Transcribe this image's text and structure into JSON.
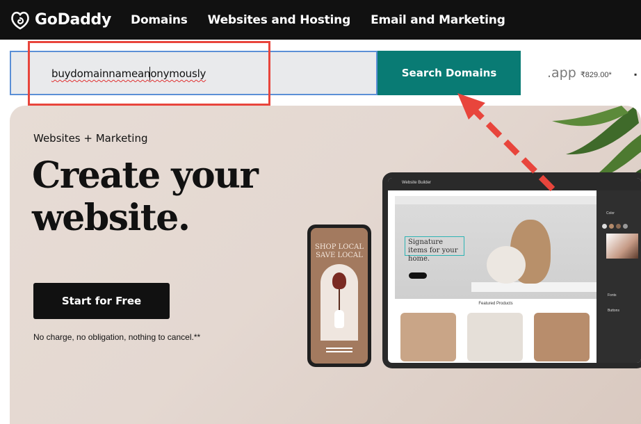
{
  "header": {
    "logo_text": "GoDaddy",
    "nav": [
      "Domains",
      "Websites and Hosting",
      "Email and Marketing"
    ]
  },
  "search": {
    "value_part1": "buydomainnamea",
    "value_part2": "nonymously",
    "button_label": "Search Domains"
  },
  "tld_promo": {
    "name": ".app",
    "price": "₹829.00*"
  },
  "hero": {
    "eyebrow": "Websites + Marketing",
    "title_line1": "Create your",
    "title_line2": "website.",
    "cta_label": "Start for Free",
    "note": "No charge, no obligation, nothing to cancel.**"
  },
  "phone_mockup": {
    "text_line1": "SHOP LOCAL",
    "text_line2": "SAVE LOCAL"
  },
  "tablet_mockup": {
    "bar_title": "Website Builder",
    "signature_text": "Signature items for your home.",
    "featured_label": "Featured Products",
    "panel_color_label": "Color",
    "panel_fonts_label": "Fonts",
    "panel_buttons_label": "Buttons"
  },
  "colors": {
    "header_bg": "#111111",
    "search_button": "#097b74",
    "annotation_red": "#e8453c",
    "search_focus_border": "#5b8fd6"
  }
}
